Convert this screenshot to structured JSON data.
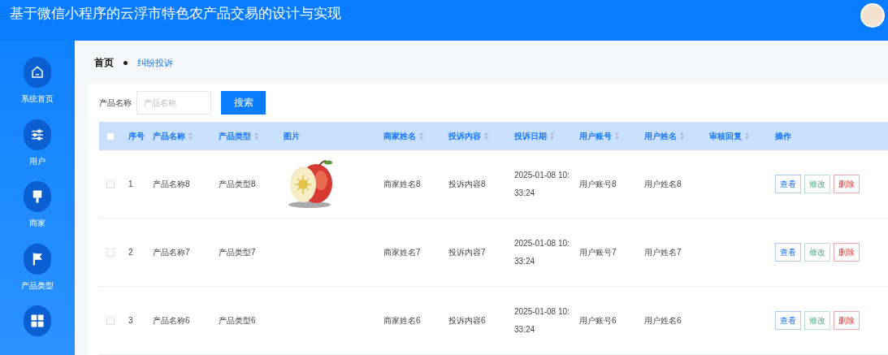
{
  "header": {
    "title": "基于微信小程序的云浮市特色农产品交易的设计与实现"
  },
  "sidebar": {
    "items": [
      {
        "label": "系统首页",
        "kind": "home"
      },
      {
        "label": "用户",
        "kind": "sliders"
      },
      {
        "label": "商家",
        "kind": "brush"
      },
      {
        "label": "产品类型",
        "kind": "flag"
      },
      {
        "kind": "grid"
      }
    ]
  },
  "breadcrumb": [
    {
      "label": "首页",
      "current": false
    },
    {
      "label": "纠纷投诉",
      "current": true
    }
  ],
  "search": {
    "label": "产品名称",
    "placeholder": "产品名称",
    "button": "搜索"
  },
  "table": {
    "select_all": {
      "checked": false
    },
    "columns": [
      {
        "label": "序号",
        "sortable": false
      },
      {
        "label": "产品名称",
        "sortable": true
      },
      {
        "label": "产品类型",
        "sortable": true
      },
      {
        "label": "图片",
        "sortable": false
      },
      {
        "label": "商家姓名",
        "sortable": true
      },
      {
        "label": "投诉内容",
        "sortable": true
      },
      {
        "label": "投诉日期",
        "sortable": true
      },
      {
        "label": "用户账号",
        "sortable": true
      },
      {
        "label": "用户姓名",
        "sortable": true
      },
      {
        "label": "审核回复",
        "sortable": true
      },
      {
        "label": "操作",
        "sortable": false
      }
    ],
    "rows": [
      {
        "checked": false,
        "cells": [
          "1",
          "产品名称8",
          "产品类型8",
          null,
          "商家姓名8",
          "投诉内容8",
          "2025-01-08 10:33:24",
          "用户账号8",
          "用户姓名8"
        ],
        "actions": [
          {
            "label": "查看",
            "kind": "view"
          },
          {
            "label": "修改",
            "kind": "edit"
          },
          {
            "label": "删除",
            "kind": "delete"
          }
        ]
      },
      {
        "checked": false,
        "cells": [
          "2",
          "产品名称7",
          "产品类型7",
          null,
          "商家姓名7",
          "投诉内容7",
          "2025-01-08 10:33:24",
          "用户账号7",
          "用户姓名7"
        ],
        "actions": [
          {
            "label": "查看",
            "kind": "view"
          },
          {
            "label": "修改",
            "kind": "edit"
          },
          {
            "label": "删除",
            "kind": "delete"
          }
        ]
      },
      {
        "checked": false,
        "cells": [
          "3",
          "产品名称6",
          "产品类型6",
          null,
          "商家姓名6",
          "投诉内容6",
          "2025-01-08 10:33:24",
          "用户账号6",
          "用户姓名6"
        ],
        "actions": [
          {
            "label": "查看",
            "kind": "view"
          },
          {
            "label": "修改",
            "kind": "edit"
          },
          {
            "label": "删除",
            "kind": "delete"
          }
        ]
      }
    ]
  }
}
